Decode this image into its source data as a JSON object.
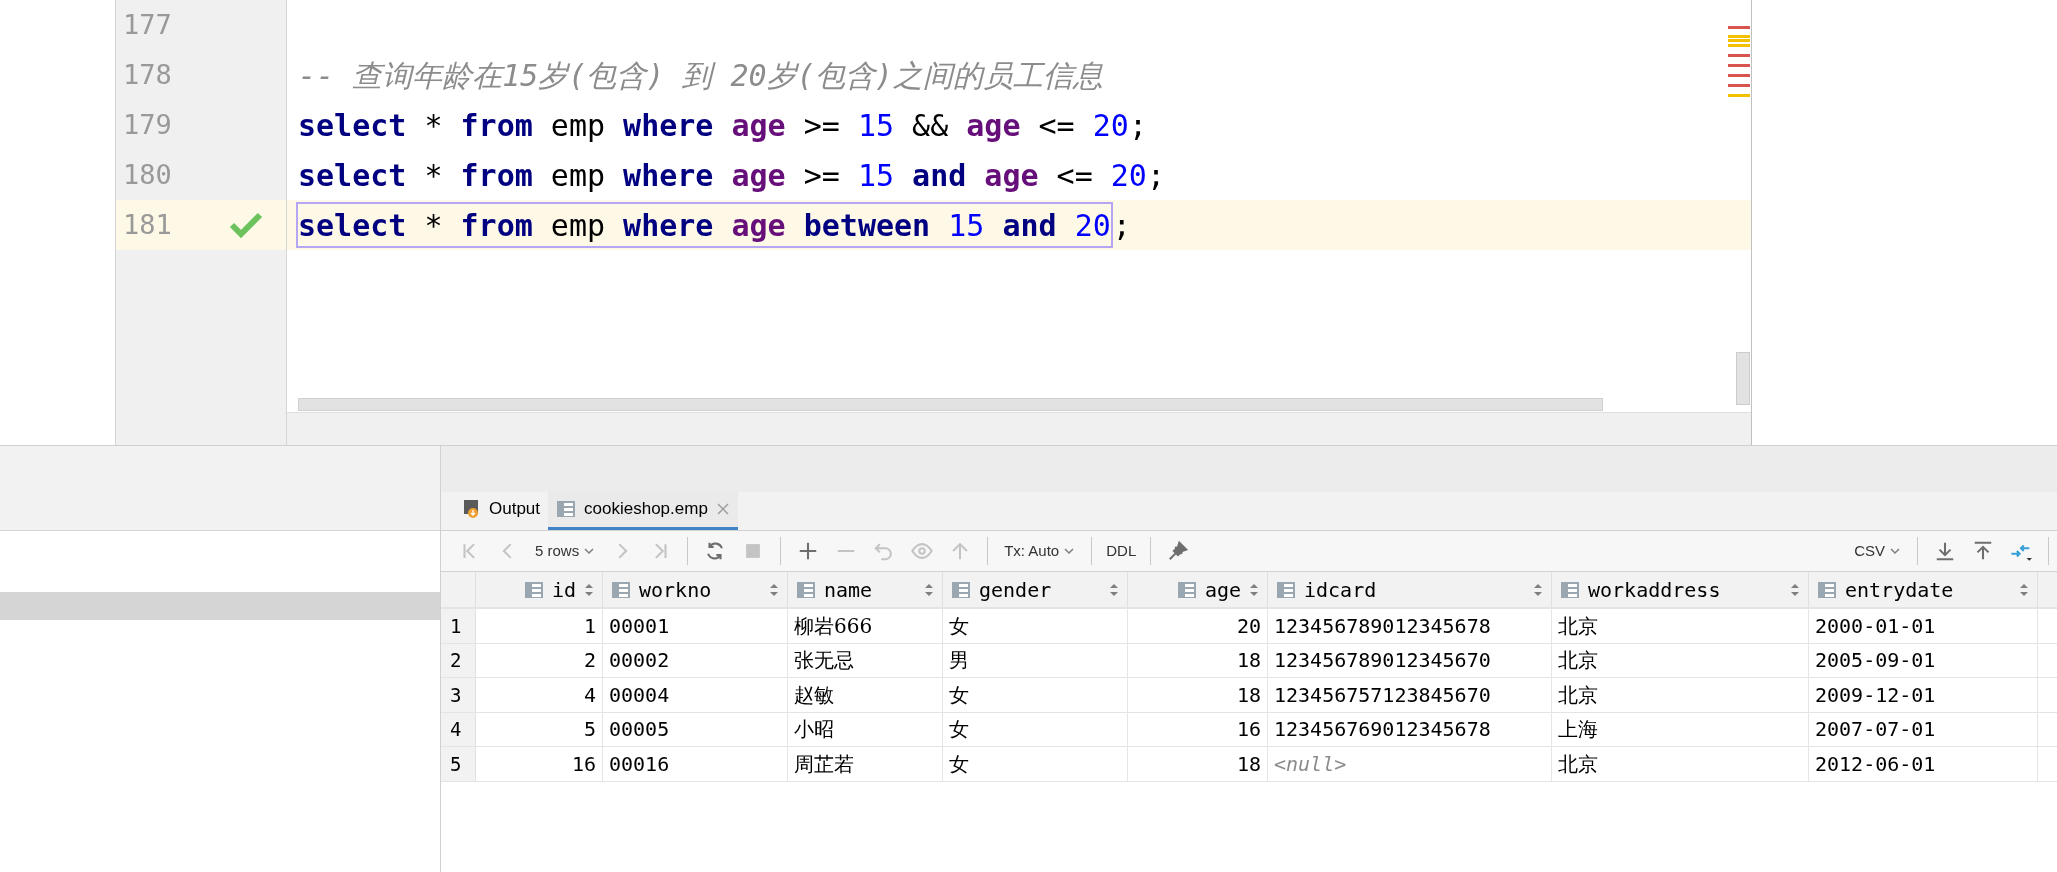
{
  "editor": {
    "lines": [
      {
        "number": "177",
        "current": false,
        "check": false
      },
      {
        "number": "178",
        "current": false,
        "check": false,
        "tokens": [
          {
            "text": "-- 查询年龄在15岁(包含) 到 20岁(包含)之间的员工信息",
            "kind": "comment"
          }
        ]
      },
      {
        "number": "179",
        "current": false,
        "check": false,
        "tokens": [
          {
            "text": "select",
            "kind": "keyword"
          },
          {
            "text": "*",
            "kind": "op"
          },
          {
            "text": "from",
            "kind": "keyword"
          },
          {
            "text": "emp",
            "kind": "ident"
          },
          {
            "text": "where",
            "kind": "keyword"
          },
          {
            "text": "age",
            "kind": "field"
          },
          {
            "text": ">=",
            "kind": "op"
          },
          {
            "text": "15",
            "kind": "number"
          },
          {
            "text": "&&",
            "kind": "op"
          },
          {
            "text": "age",
            "kind": "field"
          },
          {
            "text": "<=",
            "kind": "op"
          },
          {
            "text": "20",
            "kind": "number"
          },
          {
            "text": ";",
            "kind": "op",
            "attach": true
          }
        ]
      },
      {
        "number": "180",
        "current": false,
        "check": false,
        "tokens": [
          {
            "text": "select",
            "kind": "keyword"
          },
          {
            "text": "*",
            "kind": "op"
          },
          {
            "text": "from",
            "kind": "keyword"
          },
          {
            "text": "emp",
            "kind": "ident"
          },
          {
            "text": "where",
            "kind": "keyword"
          },
          {
            "text": "age",
            "kind": "field"
          },
          {
            "text": ">=",
            "kind": "op"
          },
          {
            "text": "15",
            "kind": "number"
          },
          {
            "text": "and",
            "kind": "keyword"
          },
          {
            "text": "age",
            "kind": "field"
          },
          {
            "text": "<=",
            "kind": "op"
          },
          {
            "text": "20",
            "kind": "number"
          },
          {
            "text": ";",
            "kind": "op",
            "attach": true
          }
        ]
      },
      {
        "number": "181",
        "current": true,
        "check": true,
        "boxed": true,
        "tokens": [
          {
            "text": "select",
            "kind": "keyword"
          },
          {
            "text": "*",
            "kind": "op"
          },
          {
            "text": "from",
            "kind": "keyword"
          },
          {
            "text": "emp",
            "kind": "ident"
          },
          {
            "text": "where",
            "kind": "keyword"
          },
          {
            "text": "age",
            "kind": "field"
          },
          {
            "text": "between",
            "kind": "keyword"
          },
          {
            "text": "15",
            "kind": "number"
          },
          {
            "text": "and",
            "kind": "keyword"
          },
          {
            "text": "20",
            "kind": "number"
          }
        ],
        "after": [
          {
            "text": ";",
            "kind": "op",
            "attach": true
          }
        ]
      }
    ]
  },
  "tabs": [
    {
      "label": "Output",
      "kind": "output",
      "selected": false
    },
    {
      "label": "cookieshop.emp",
      "kind": "table",
      "selected": true,
      "closable": true
    }
  ],
  "toolbar": [
    {
      "kind": "first",
      "disabled": true
    },
    {
      "kind": "prev",
      "disabled": true
    },
    {
      "kind": "dropdown",
      "label": "5 rows"
    },
    {
      "kind": "next",
      "disabled": true
    },
    {
      "kind": "last",
      "disabled": true
    },
    {
      "kind": "sep"
    },
    {
      "kind": "reload",
      "disabled": false
    },
    {
      "kind": "stop",
      "disabled": true
    },
    {
      "kind": "sep"
    },
    {
      "kind": "add",
      "disabled": false
    },
    {
      "kind": "remove",
      "disabled": true
    },
    {
      "kind": "revert",
      "disabled": true
    },
    {
      "kind": "preview",
      "disabled": true
    },
    {
      "kind": "submit",
      "disabled": true
    },
    {
      "kind": "sep"
    },
    {
      "kind": "dropdown",
      "label": "Tx: Auto"
    },
    {
      "kind": "sep"
    },
    {
      "kind": "text",
      "label": "DDL"
    },
    {
      "kind": "sep"
    },
    {
      "kind": "pin",
      "disabled": false
    },
    {
      "kind": "spacer"
    },
    {
      "kind": "dropdown",
      "label": "CSV"
    },
    {
      "kind": "sep"
    },
    {
      "kind": "download",
      "disabled": false
    },
    {
      "kind": "upload",
      "disabled": false
    },
    {
      "kind": "compare",
      "disabled": false
    },
    {
      "kind": "sep"
    }
  ],
  "table": {
    "columns": [
      {
        "label": "id",
        "right_aligned": true
      },
      {
        "label": "workno",
        "right_aligned": false
      },
      {
        "label": "name",
        "right_aligned": false
      },
      {
        "label": "gender",
        "right_aligned": false
      },
      {
        "label": "age",
        "right_aligned": true
      },
      {
        "label": "idcard",
        "right_aligned": false
      },
      {
        "label": "workaddress",
        "right_aligned": false
      },
      {
        "label": "entrydate",
        "right_aligned": false
      }
    ],
    "rows": [
      {
        "number": "1",
        "cells": [
          "1",
          "00001",
          "柳岩666",
          "女",
          "20",
          "123456789012345678",
          "北京",
          "2000-01-01"
        ]
      },
      {
        "number": "2",
        "cells": [
          "2",
          "00002",
          "张无忌",
          "男",
          "18",
          "123456789012345670",
          "北京",
          "2005-09-01"
        ]
      },
      {
        "number": "3",
        "cells": [
          "4",
          "00004",
          "赵敏",
          "女",
          "18",
          "123456757123845670",
          "北京",
          "2009-12-01"
        ]
      },
      {
        "number": "4",
        "cells": [
          "5",
          "00005",
          "小昭",
          "女",
          "16",
          "123456769012345678",
          "上海",
          "2007-07-01"
        ]
      },
      {
        "number": "5",
        "cells": [
          "16",
          "00016",
          "周芷若",
          "女",
          "18",
          {
            "text": "<null>",
            "kind": "null"
          },
          "北京",
          "2012-06-01"
        ]
      }
    ]
  }
}
